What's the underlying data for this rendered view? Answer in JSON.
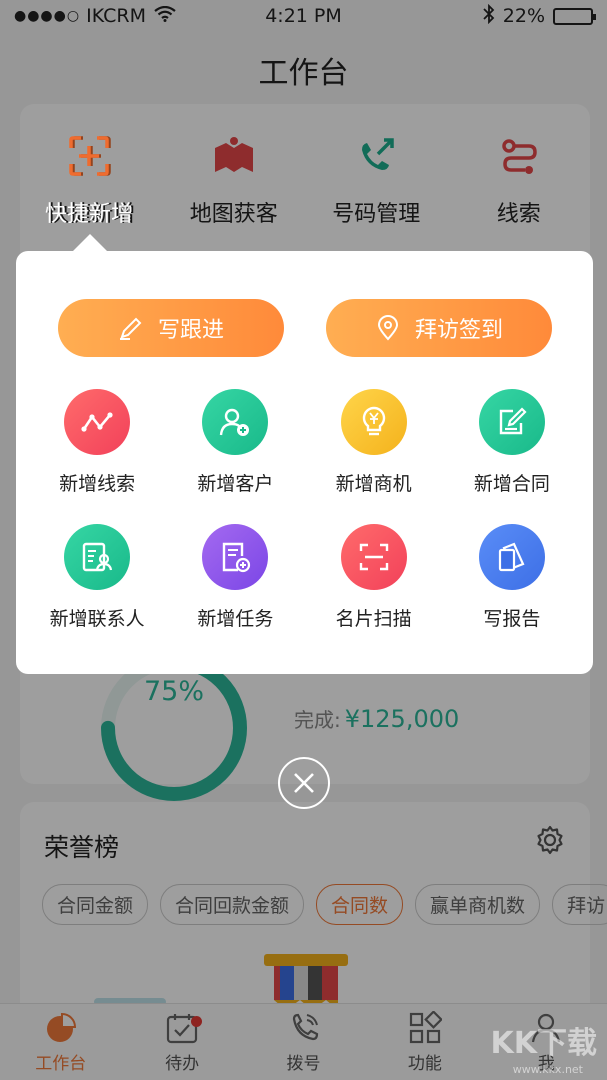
{
  "status": {
    "carrier": "IKCRM",
    "time": "4:21 PM",
    "battery": "22%"
  },
  "page": {
    "title": "工作台"
  },
  "quick_menu": [
    {
      "label": "快捷新增",
      "icon": "scan-plus-icon"
    },
    {
      "label": "地图获客",
      "icon": "map-icon"
    },
    {
      "label": "号码管理",
      "icon": "phone-arrow-icon"
    },
    {
      "label": "线索",
      "icon": "route-icon"
    }
  ],
  "popup": {
    "buttons": [
      {
        "label": "写跟进",
        "icon": "pencil-icon"
      },
      {
        "label": "拜访签到",
        "icon": "location-pin-icon"
      }
    ],
    "grid": [
      {
        "label": "新增线索",
        "icon": "trend-line-icon",
        "color": "#f2415a"
      },
      {
        "label": "新增客户",
        "icon": "add-user-icon",
        "color": "#19b98a"
      },
      {
        "label": "新增商机",
        "icon": "lightbulb-yen-icon",
        "color": "#f4b21c"
      },
      {
        "label": "新增合同",
        "icon": "edit-document-icon",
        "color": "#19b98a"
      },
      {
        "label": "新增联系人",
        "icon": "contact-card-icon",
        "color": "#19b98a"
      },
      {
        "label": "新增任务",
        "icon": "task-add-icon",
        "color": "#7b46e6"
      },
      {
        "label": "名片扫描",
        "icon": "scan-card-icon",
        "color": "#f2415a"
      },
      {
        "label": "写报告",
        "icon": "report-icon",
        "color": "#3d6fe6"
      }
    ]
  },
  "target": {
    "percent_text": "75%",
    "percent": 75,
    "done_label": "完成:",
    "done_value": "¥125,000"
  },
  "honor": {
    "title": "荣誉榜",
    "chips": [
      "合同金额",
      "合同回款金额",
      "合同数",
      "赢单商机数",
      "拜访"
    ],
    "active_chip": 2
  },
  "tabs": [
    {
      "label": "工作台",
      "icon": "pie-chart-icon",
      "active": true
    },
    {
      "label": "待办",
      "icon": "calendar-check-icon",
      "badge": true
    },
    {
      "label": "拨号",
      "icon": "phone-icon"
    },
    {
      "label": "功能",
      "icon": "grid-apps-icon"
    },
    {
      "label": "我",
      "icon": "person-icon"
    }
  ],
  "colors": {
    "accent": "#f07a3a",
    "teal": "#2cb79a"
  },
  "watermark": {
    "text": "KK下载",
    "sub": "www.kkx.net"
  }
}
